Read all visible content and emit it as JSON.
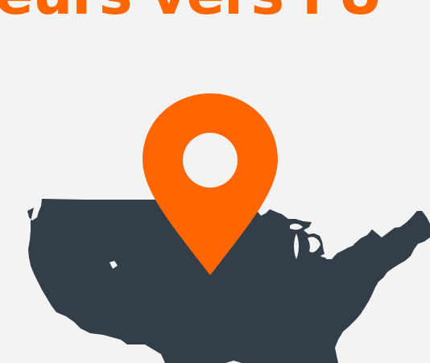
{
  "headline": {
    "text": "eurs vers l'U"
  },
  "colors": {
    "background": "#f3f3f3",
    "accent": "#ff6600",
    "map": "#333e48",
    "pin_hole": "#f3f3f3"
  },
  "icons": {
    "map": "us-map-icon",
    "pin": "location-pin-icon"
  }
}
